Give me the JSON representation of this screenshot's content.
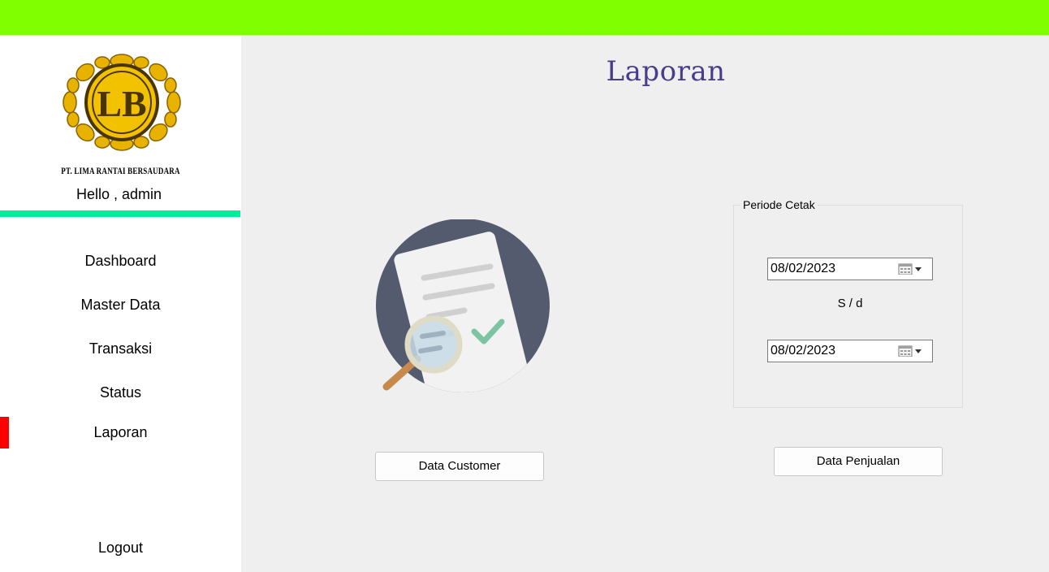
{
  "company": {
    "name": "PT. LIMA RANTAI BERSAUDARA",
    "logo_text": "LB"
  },
  "user": {
    "greeting": "Hello , admin"
  },
  "sidebar": {
    "items": [
      {
        "label": "Dashboard"
      },
      {
        "label": "Master Data"
      },
      {
        "label": "Transaksi"
      },
      {
        "label": "Status"
      },
      {
        "label": "Laporan",
        "active": true
      }
    ],
    "logout_label": "Logout"
  },
  "main": {
    "title": "Laporan",
    "illustration_icon": "report-search-icon",
    "customer_button_label": "Data Customer",
    "period": {
      "legend": "Periode Cetak",
      "start_date": "08/02/2023",
      "separator": "S / d",
      "end_date": "08/02/2023",
      "calendar_icon": "calendar-dropdown-icon"
    },
    "sales_button_label": "Data Penjualan"
  },
  "colors": {
    "topbar": "#80ff00",
    "divider": "#00ee99",
    "active_marker": "#ff0000",
    "title": "#483d8b",
    "logo_gold": "#e8b200"
  }
}
